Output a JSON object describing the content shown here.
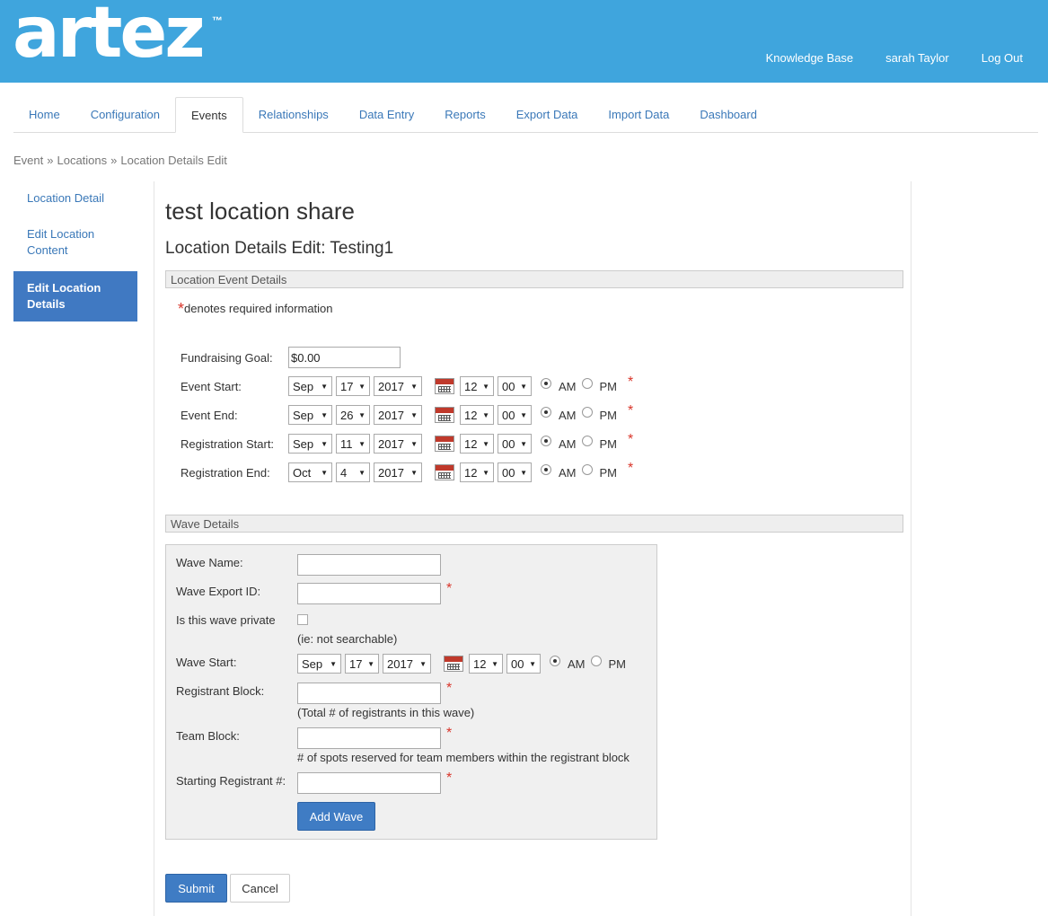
{
  "brand": {
    "logo_text": "artez",
    "tm": "™"
  },
  "top_nav": {
    "knowledge_base": "Knowledge Base",
    "user": "sarah Taylor",
    "logout": "Log Out"
  },
  "tabs": [
    "Home",
    "Configuration",
    "Events",
    "Relationships",
    "Data Entry",
    "Reports",
    "Export Data",
    "Import Data",
    "Dashboard"
  ],
  "active_tab": "Events",
  "breadcrumb": {
    "items": [
      "Event",
      "Locations",
      "Location Details Edit"
    ],
    "separator": "»"
  },
  "sidebar": {
    "items": [
      {
        "label": "Location Detail"
      },
      {
        "label": "Edit Location Content"
      },
      {
        "label": "Edit Location Details"
      }
    ]
  },
  "main": {
    "title": "test location share",
    "subtitle": "Location Details Edit: Testing1",
    "section1": "Location Event Details",
    "required_star": "*",
    "required_note": "denotes required information",
    "goal_label": "Fundraising Goal:",
    "goal_value": "$0.00",
    "am": "AM",
    "pm": "PM",
    "dates": [
      {
        "label": "Event Start:",
        "month": "Sep",
        "day": "17",
        "year": "2017",
        "hour": "12",
        "minute": "00"
      },
      {
        "label": "Event End:",
        "month": "Sep",
        "day": "26",
        "year": "2017",
        "hour": "12",
        "minute": "00"
      },
      {
        "label": "Registration Start:",
        "month": "Sep",
        "day": "11",
        "year": "2017",
        "hour": "12",
        "minute": "00"
      },
      {
        "label": "Registration End:",
        "month": "Oct",
        "day": "4",
        "year": "2017",
        "hour": "12",
        "minute": "00"
      }
    ],
    "section2": "Wave Details",
    "wave": {
      "name_label": "Wave Name:",
      "export_label": "Wave Export ID:",
      "private_label": "Is this wave private",
      "private_help": "(ie: not searchable)",
      "start_label": "Wave Start:",
      "start": {
        "month": "Sep",
        "day": "17",
        "year": "2017",
        "hour": "12",
        "minute": "00"
      },
      "reg_block_label": "Registrant Block:",
      "reg_block_help": "(Total # of registrants in this wave)",
      "team_block_label": "Team Block:",
      "team_block_help": "# of spots reserved for team members within the registrant block",
      "starting_label": "Starting Registrant #:",
      "add_button": "Add Wave"
    },
    "submit": "Submit",
    "cancel": "Cancel"
  },
  "colors": {
    "header": "#3fa5dd",
    "link": "#3a78b8",
    "primary": "#3f7cc4",
    "required": "#d9362b"
  }
}
